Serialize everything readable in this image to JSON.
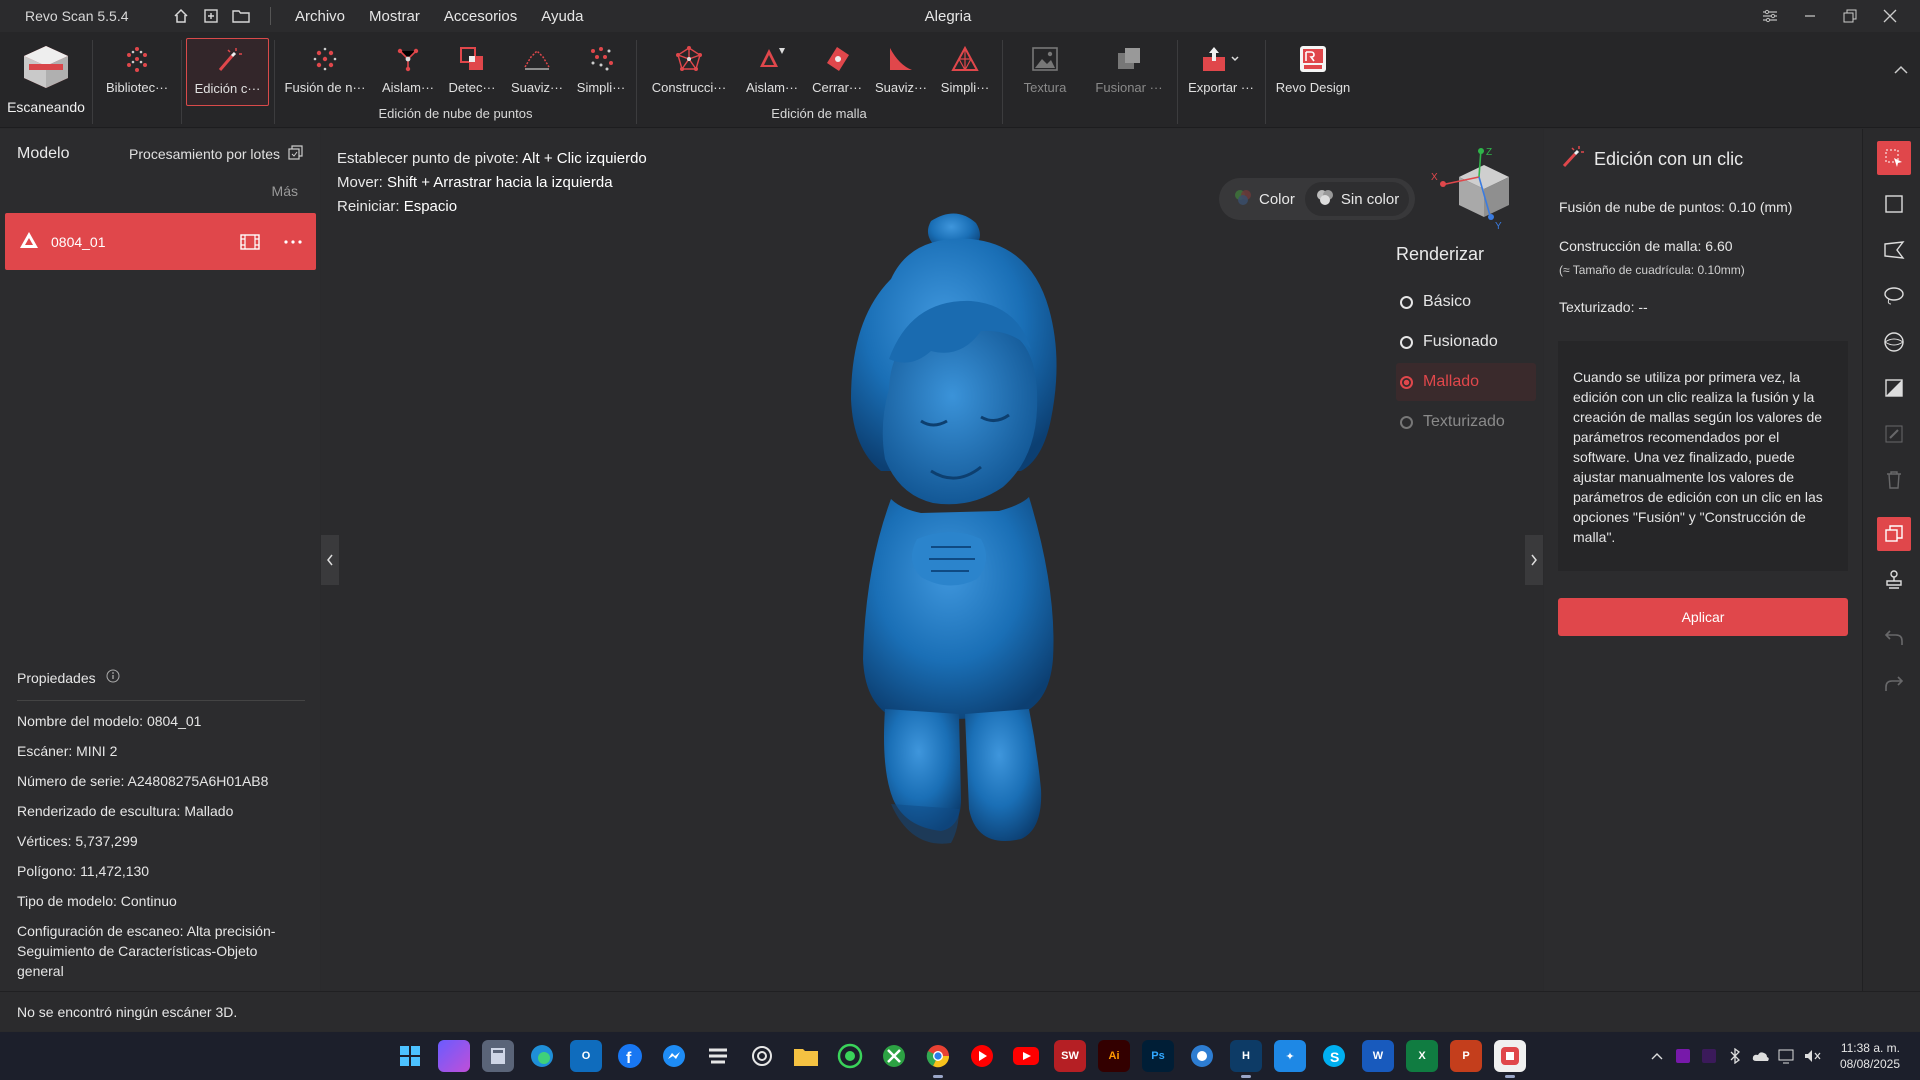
{
  "titlebar": {
    "app_name": "Revo Scan 5.5.4",
    "menu": [
      "Archivo",
      "Mostrar",
      "Accesorios",
      "Ayuda"
    ],
    "window_title": "Alegria"
  },
  "toolbar": {
    "scanning": "Escaneando",
    "library": "Bibliotec···",
    "one_click": "Edición c···",
    "pc_fusion": "Fusión de n···",
    "pc_isolate": "Aislam···",
    "pc_detect": "Detec···",
    "pc_smooth": "Suaviz···",
    "pc_simplify": "Simpli···",
    "mesh_build": "Construcci···",
    "mesh_isolate": "Aislam···",
    "mesh_close": "Cerrar···",
    "mesh_smooth": "Suaviz···",
    "mesh_simplify": "Simpli···",
    "texture": "Textura",
    "merge": "Fusionar ···",
    "export": "Exportar ···",
    "revo_design": "Revo Design",
    "group_pointcloud": "Edición de nube de puntos",
    "group_mesh": "Edición de malla"
  },
  "left_panel": {
    "title": "Modelo",
    "batch": "Procesamiento por lotes",
    "more": "Más",
    "model_name": "0804_01",
    "props_title": "Propiedades",
    "props": [
      {
        "label": "Nombre del modelo:",
        "value": "0804_01"
      },
      {
        "label": "Escáner:",
        "value": "MINI 2"
      },
      {
        "label": "Número de serie:",
        "value": "A24808275A6H01AB8"
      },
      {
        "label": "Renderizado de escultura:",
        "value": "Mallado"
      },
      {
        "label": "Vértices:",
        "value": "5,737,299"
      },
      {
        "label": "Polígono:",
        "value": "11,472,130"
      },
      {
        "label": "Tipo de modelo:",
        "value": "Continuo"
      },
      {
        "label": "Configuración de escaneo:",
        "value": "Alta precisión-Seguimiento de Características-Objeto general"
      }
    ]
  },
  "viewport": {
    "hints": [
      {
        "label": "Establecer punto de pivote:",
        "key": "Alt + Clic izquierdo"
      },
      {
        "label": "Mover:",
        "key": "Shift + Arrastrar hacia la izquierda"
      },
      {
        "label": "Reiniciar:",
        "key": "Espacio"
      }
    ],
    "color_label": "Color",
    "nocolor_label": "Sin color",
    "render_title": "Renderizar",
    "render_options": [
      "Básico",
      "Fusionado",
      "Mallado",
      "Texturizado"
    ],
    "render_selected": "Mallado",
    "axis_labels": {
      "z": "Z",
      "x": "X",
      "y": "Y"
    }
  },
  "right_panel": {
    "title": "Edición con un clic",
    "pc_fusion_label": "Fusión de nube de puntos:",
    "pc_fusion_value": "0.10 (mm)",
    "mesh_label": "Construcción de malla:",
    "mesh_value": "6.60",
    "grid_note": "(≈ Tamaño de cuadrícula: 0.10mm)",
    "texture_label": "Texturizado:",
    "texture_value": "--",
    "info": "Cuando se utiliza por primera vez, la edición con un clic realiza la fusión y la creación de mallas según los valores de parámetros recomendados por el software. Una vez finalizado, puede ajustar manualmente los valores de parámetros de edición con un clic en las opciones \"Fusión\" y \"Construcción de malla\".",
    "apply": "Aplicar"
  },
  "status": {
    "message": "No se encontró ningún escáner 3D."
  },
  "taskbar": {
    "time": "11:38 a. m.",
    "date": "08/08/2025",
    "apps": [
      "start",
      "file-manager",
      "calculator",
      "edge",
      "outlook",
      "facebook",
      "messenger",
      "stack",
      "chatgpt",
      "explorer",
      "whatsapp",
      "xbox",
      "chrome",
      "youtube-music",
      "youtube",
      "solidworks",
      "illustrator",
      "photoshop",
      "app-a",
      "app-b",
      "app-c",
      "app-d",
      "word",
      "excel",
      "powerpoint",
      "revo-scan"
    ]
  },
  "colors": {
    "accent": "#e0474b",
    "model": "#1a72b8",
    "panel": "#2c2c2e",
    "background": "#2a2a2c"
  }
}
